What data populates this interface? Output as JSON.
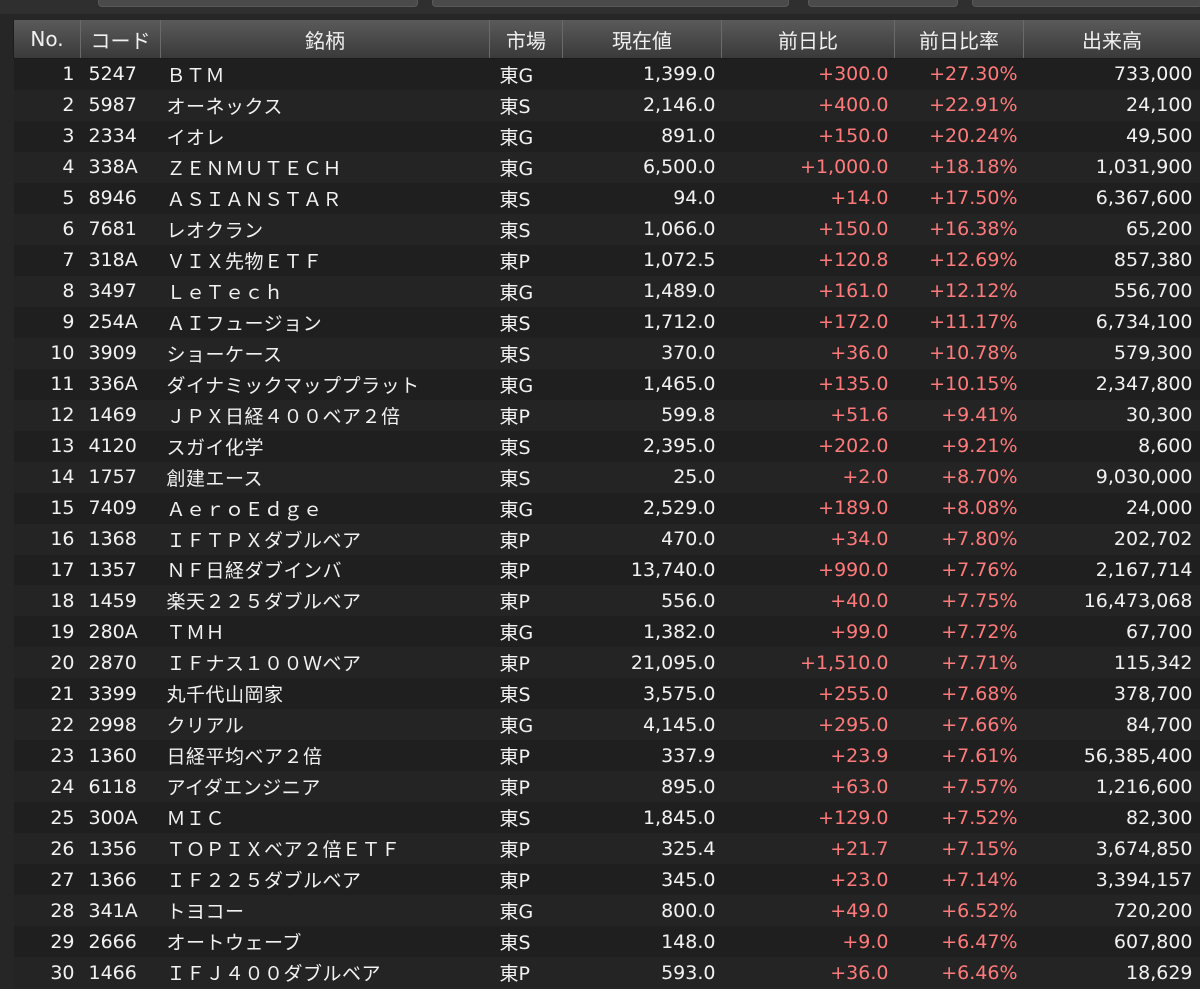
{
  "colors": {
    "price_red": "#ff7272",
    "price_green": "#9cff6e",
    "change_red": "#ff7a7a"
  },
  "headers": {
    "no": "No.",
    "code": "コード",
    "name": "銘柄",
    "market": "市場",
    "price": "現在値",
    "change": "前日比",
    "change_pct": "前日比率",
    "volume": "出来高"
  },
  "rows": [
    {
      "no": "1",
      "code": "5247",
      "name": "ＢＴＭ",
      "market": "東G",
      "price": "1,399.0",
      "price_color": "red",
      "change": "+300.0",
      "change_pct": "+27.30%",
      "volume": "733,000"
    },
    {
      "no": "2",
      "code": "5987",
      "name": "オーネックス",
      "market": "東S",
      "price": "2,146.0",
      "price_color": "red",
      "change": "+400.0",
      "change_pct": "+22.91%",
      "volume": "24,100"
    },
    {
      "no": "3",
      "code": "2334",
      "name": "イオレ",
      "market": "東G",
      "price": "891.0",
      "price_color": "red",
      "change": "+150.0",
      "change_pct": "+20.24%",
      "volume": "49,500"
    },
    {
      "no": "4",
      "code": "338A",
      "name": "ＺＥＮＭＵＴＥＣＨ",
      "market": "東G",
      "price": "6,500.0",
      "price_color": "red",
      "change": "+1,000.0",
      "change_pct": "+18.18%",
      "volume": "1,031,900"
    },
    {
      "no": "5",
      "code": "8946",
      "name": "ＡＳＩＡＮＳＴＡＲ",
      "market": "東S",
      "price": "94.0",
      "price_color": "red",
      "change": "+14.0",
      "change_pct": "+17.50%",
      "volume": "6,367,600"
    },
    {
      "no": "6",
      "code": "7681",
      "name": "レオクラン",
      "market": "東S",
      "price": "1,066.0",
      "price_color": "red",
      "change": "+150.0",
      "change_pct": "+16.38%",
      "volume": "65,200"
    },
    {
      "no": "7",
      "code": "318A",
      "name": "ＶＩＸ先物ＥＴＦ",
      "market": "東P",
      "price": "1,072.5",
      "price_color": "red",
      "change": "+120.8",
      "change_pct": "+12.69%",
      "volume": "857,380"
    },
    {
      "no": "8",
      "code": "3497",
      "name": "ＬｅＴｅｃｈ",
      "market": "東G",
      "price": "1,489.0",
      "price_color": "green",
      "change": "+161.0",
      "change_pct": "+12.12%",
      "volume": "556,700"
    },
    {
      "no": "9",
      "code": "254A",
      "name": "ＡＩフュージョン",
      "market": "東S",
      "price": "1,712.0",
      "price_color": "green",
      "change": "+172.0",
      "change_pct": "+11.17%",
      "volume": "6,734,100"
    },
    {
      "no": "10",
      "code": "3909",
      "name": "ショーケース",
      "market": "東S",
      "price": "370.0",
      "price_color": "red",
      "change": "+36.0",
      "change_pct": "+10.78%",
      "volume": "579,300"
    },
    {
      "no": "11",
      "code": "336A",
      "name": "ダイナミックマッププラット",
      "market": "東G",
      "price": "1,465.0",
      "price_color": "green",
      "change": "+135.0",
      "change_pct": "+10.15%",
      "volume": "2,347,800"
    },
    {
      "no": "12",
      "code": "1469",
      "name": "ＪＰＸ日経４００ベア２倍",
      "market": "東P",
      "price": "599.8",
      "price_color": "red",
      "change": "+51.6",
      "change_pct": "+9.41%",
      "volume": "30,300"
    },
    {
      "no": "13",
      "code": "4120",
      "name": "スガイ化学",
      "market": "東S",
      "price": "2,395.0",
      "price_color": "green",
      "change": "+202.0",
      "change_pct": "+9.21%",
      "volume": "8,600"
    },
    {
      "no": "14",
      "code": "1757",
      "name": "創建エース",
      "market": "東S",
      "price": "25.0",
      "price_color": "green",
      "change": "+2.0",
      "change_pct": "+8.70%",
      "volume": "9,030,000"
    },
    {
      "no": "15",
      "code": "7409",
      "name": "ＡｅｒｏＥｄｇｅ",
      "market": "東G",
      "price": "2,529.0",
      "price_color": "red",
      "change": "+189.0",
      "change_pct": "+8.08%",
      "volume": "24,000"
    },
    {
      "no": "16",
      "code": "1368",
      "name": "ＩＦＴＰＸダブルベア",
      "market": "東P",
      "price": "470.0",
      "price_color": "red",
      "change": "+34.0",
      "change_pct": "+7.80%",
      "volume": "202,702"
    },
    {
      "no": "17",
      "code": "1357",
      "name": "ＮＦ日経ダブインバ",
      "market": "東P",
      "price": "13,740.0",
      "price_color": "green",
      "change": "+990.0",
      "change_pct": "+7.76%",
      "volume": "2,167,714"
    },
    {
      "no": "18",
      "code": "1459",
      "name": "楽天２２５ダブルベア",
      "market": "東P",
      "price": "556.0",
      "price_color": "red",
      "change": "+40.0",
      "change_pct": "+7.75%",
      "volume": "16,473,068"
    },
    {
      "no": "19",
      "code": "280A",
      "name": "ＴＭＨ",
      "market": "東G",
      "price": "1,382.0",
      "price_color": "red",
      "change": "+99.0",
      "change_pct": "+7.72%",
      "volume": "67,700"
    },
    {
      "no": "20",
      "code": "2870",
      "name": "ＩＦナス１００Ｗベア",
      "market": "東P",
      "price": "21,095.0",
      "price_color": "red",
      "change": "+1,510.0",
      "change_pct": "+7.71%",
      "volume": "115,342"
    },
    {
      "no": "21",
      "code": "3399",
      "name": "丸千代山岡家",
      "market": "東S",
      "price": "3,575.0",
      "price_color": "green",
      "change": "+255.0",
      "change_pct": "+7.68%",
      "volume": "378,700"
    },
    {
      "no": "22",
      "code": "2998",
      "name": "クリアル",
      "market": "東G",
      "price": "4,145.0",
      "price_color": "red",
      "change": "+295.0",
      "change_pct": "+7.66%",
      "volume": "84,700"
    },
    {
      "no": "23",
      "code": "1360",
      "name": "日経平均ベア２倍",
      "market": "東P",
      "price": "337.9",
      "price_color": "red",
      "change": "+23.9",
      "change_pct": "+7.61%",
      "volume": "56,385,400"
    },
    {
      "no": "24",
      "code": "6118",
      "name": "アイダエンジニア",
      "market": "東P",
      "price": "895.0",
      "price_color": "red",
      "change": "+63.0",
      "change_pct": "+7.57%",
      "volume": "1,216,600"
    },
    {
      "no": "25",
      "code": "300A",
      "name": "ＭＩＣ",
      "market": "東S",
      "price": "1,845.0",
      "price_color": "red",
      "change": "+129.0",
      "change_pct": "+7.52%",
      "volume": "82,300"
    },
    {
      "no": "26",
      "code": "1356",
      "name": "ＴＯＰＩＸベア２倍ＥＴＦ",
      "market": "東P",
      "price": "325.4",
      "price_color": "red",
      "change": "+21.7",
      "change_pct": "+7.15%",
      "volume": "3,674,850"
    },
    {
      "no": "27",
      "code": "1366",
      "name": "ＩＦ２２５ダブルベア",
      "market": "東P",
      "price": "345.0",
      "price_color": "green",
      "change": "+23.0",
      "change_pct": "+7.14%",
      "volume": "3,394,157"
    },
    {
      "no": "28",
      "code": "341A",
      "name": "トヨコー",
      "market": "東G",
      "price": "800.0",
      "price_color": "red",
      "change": "+49.0",
      "change_pct": "+6.52%",
      "volume": "720,200"
    },
    {
      "no": "29",
      "code": "2666",
      "name": "オートウェーブ",
      "market": "東S",
      "price": "148.0",
      "price_color": "red",
      "change": "+9.0",
      "change_pct": "+6.47%",
      "volume": "607,800"
    },
    {
      "no": "30",
      "code": "1466",
      "name": "ＩＦＪ４００ダブルベア",
      "market": "東P",
      "price": "593.0",
      "price_color": "red",
      "change": "+36.0",
      "change_pct": "+6.46%",
      "volume": "18,629"
    }
  ]
}
